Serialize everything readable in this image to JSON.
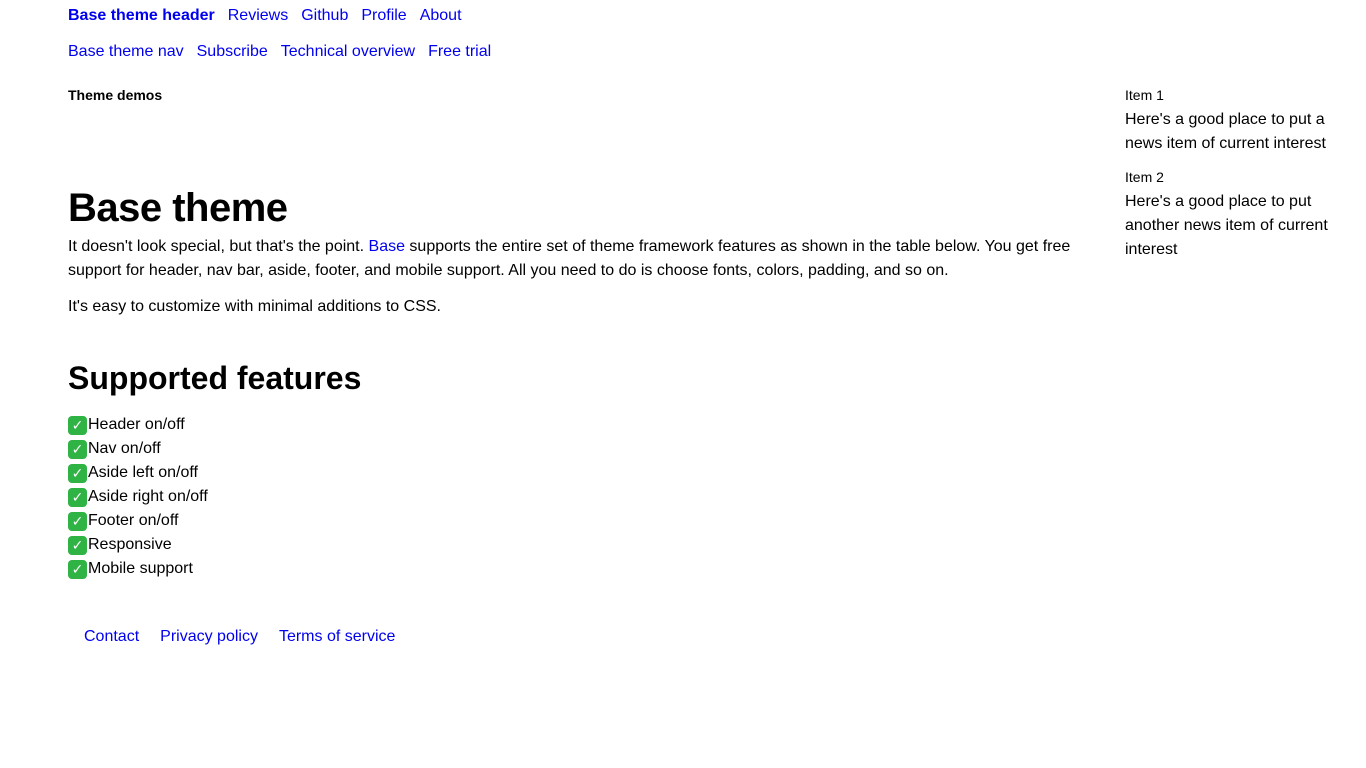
{
  "header": {
    "brand": "Base theme header",
    "links": [
      "Reviews",
      "Github",
      "Profile",
      "About"
    ]
  },
  "nav": {
    "links": [
      "Base theme nav",
      "Subscribe",
      "Technical overview",
      "Free trial"
    ]
  },
  "main": {
    "demos_label": "Theme demos",
    "title": "Base theme",
    "intro_before": "It doesn't look special, but that's the point. ",
    "intro_link": "Base",
    "intro_after": " supports the entire set of theme framework features as shown in the table below. You get free support for header, nav bar, aside, footer, and mobile support. All you need to do is choose fonts, colors, padding, and so on.",
    "intro2": "It's easy to customize with minimal additions to CSS.",
    "features_heading": "Supported features",
    "check_icon": "✓",
    "features": [
      "Header on/off",
      "Nav on/off",
      "Aside left on/off",
      "Aside right on/off",
      "Footer on/off",
      "Responsive",
      "Mobile support"
    ]
  },
  "aside": {
    "items": [
      {
        "title": "Item 1",
        "body": "Here's a good place to put a news item of current interest"
      },
      {
        "title": "Item 2",
        "body": "Here's a good place to put another news item of current interest"
      }
    ]
  },
  "footer": {
    "links": [
      "Contact",
      "Privacy policy",
      "Terms of service"
    ]
  },
  "colors": {
    "link": "#0000ee",
    "check_bg": "#2fb344",
    "text": "#000000",
    "background": "#ffffff"
  }
}
